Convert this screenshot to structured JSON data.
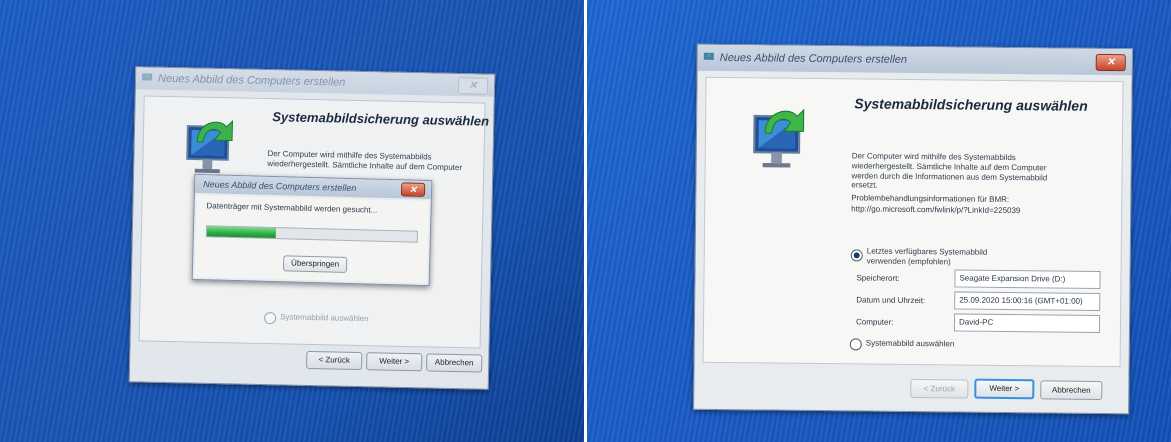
{
  "left_photo": {
    "main_window": {
      "title": "Neues Abbild des Computers erstellen",
      "heading": "Systemabbildsicherung auswählen",
      "description": "Der Computer wird mithilfe des Systemabbilds wiederhergestellt. Sämtliche Inhalte auf dem Computer",
      "select_image_option": "Systemabbild auswählen",
      "buttons": {
        "back": "< Zurück",
        "next": "Weiter >",
        "cancel": "Abbrechen"
      }
    },
    "progress_dialog": {
      "title": "Neues Abbild des Computers erstellen",
      "message": "Datenträger mit Systemabbild werden gesucht...",
      "progress": 0.33,
      "skip_button": "Überspringen"
    }
  },
  "right_photo": {
    "title": "Neues Abbild des Computers erstellen",
    "heading": "Systemabbildsicherung auswählen",
    "description": "Der Computer wird mithilfe des Systemabbilds wiederhergestellt. Sämtliche Inhalte auf dem Computer werden durch die Informationen aus dem Systemabbild ersetzt.",
    "info_line1": "Problembehandlungsinformationen für BMR:",
    "info_line2": "http://go.microsoft.com/fwlink/p/?LinkId=225039",
    "option_latest": "Letztes verfügbares Systemabbild verwenden (empfohlen)",
    "details": {
      "location_label": "Speicherort:",
      "location_value": "Seagate Expansion Drive (D:)",
      "date_label": "Datum und Uhrzeit:",
      "date_value": "25.09.2020 15:00:16 (GMT+01:00)",
      "computer_label": "Computer:",
      "computer_value": "David-PC"
    },
    "option_select": "Systemabbild auswählen",
    "buttons": {
      "back": "< Zurück",
      "next": "Weiter >",
      "cancel": "Abbrechen"
    },
    "selected_option": "latest"
  },
  "colors": {
    "desktop_blue": "#1a5cc6",
    "progress_green": "#2fae45",
    "close_red": "#c8452c",
    "focus_blue": "#3a8fe0"
  },
  "icons": [
    "restore-computer-icon",
    "window-app-icon",
    "close-icon",
    "radio-button-icon"
  ]
}
